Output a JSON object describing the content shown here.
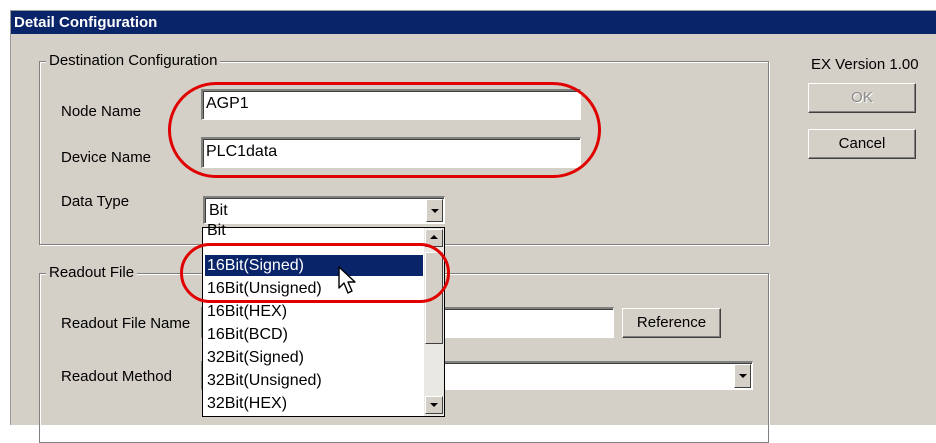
{
  "window": {
    "title": "Detail Configuration"
  },
  "version_label": "EX Version 1.00",
  "buttons": {
    "ok": "OK",
    "cancel": "Cancel",
    "reference": "Reference"
  },
  "destination": {
    "group_title": "Destination Configuration",
    "node_name_label": "Node Name",
    "node_name_value": "AGP1",
    "device_name_label": "Device Name",
    "device_name_value": "PLC1data",
    "data_type_label": "Data Type",
    "data_type_value": "Bit"
  },
  "readout": {
    "group_title": "Readout File",
    "file_name_label": "Readout File Name",
    "method_label": "Readout Method"
  },
  "dropdown": {
    "options": [
      "Bit",
      "16Bit(Signed)",
      "16Bit(Unsigned)",
      "16Bit(HEX)",
      "16Bit(BCD)",
      "32Bit(Signed)",
      "32Bit(Unsigned)",
      "32Bit(HEX)"
    ],
    "highlighted": "16Bit(Signed)"
  },
  "colors": {
    "highlight": "#0a246a",
    "callout": "#e00000",
    "face": "#d4d0c8"
  }
}
